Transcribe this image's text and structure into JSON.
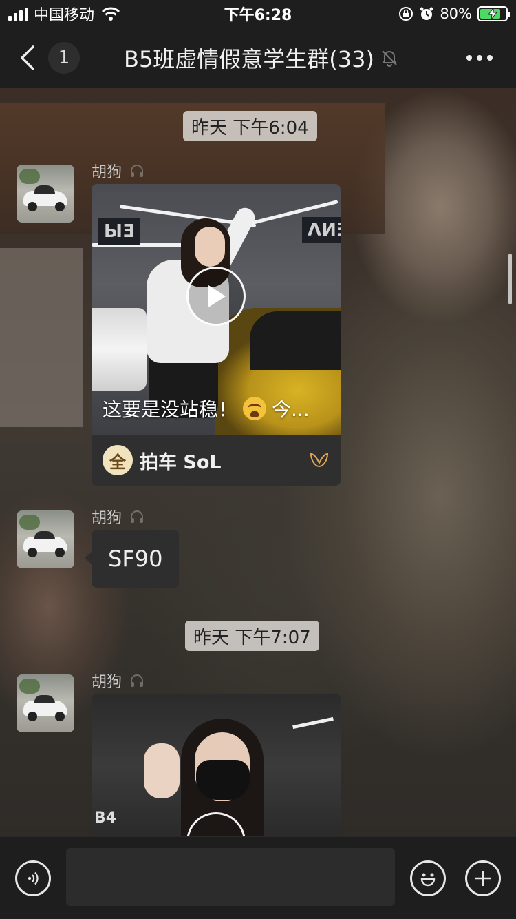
{
  "status_bar": {
    "carrier": "中国移动",
    "time": "下午6:28",
    "battery_percent": "80%",
    "battery_level": 0.8
  },
  "nav": {
    "unread_count": "1",
    "title": "B5班虚情假意学生群(33)",
    "icons": [
      "chevron-left-icon",
      "mute-bell-icon",
      "more-dots-icon"
    ]
  },
  "messages": [
    {
      "type": "timestamp",
      "text": "昨天 下午6:04"
    },
    {
      "type": "video",
      "sender": "胡狗",
      "caption": "这要是没站稳！",
      "caption_tail": "今...",
      "channel_name": "拍车 SoL",
      "channel_logo_char": "全"
    },
    {
      "type": "text",
      "sender": "胡狗",
      "text": "SF90"
    },
    {
      "type": "timestamp",
      "text": "昨天 下午7:07"
    },
    {
      "type": "video",
      "sender": "胡狗",
      "thumb_sign": "B4"
    }
  ],
  "input_bar": {
    "value": "",
    "icons": [
      "voice-icon",
      "emoji-icon",
      "plus-icon"
    ]
  },
  "colors": {
    "bar_bg": "#1e1e1e",
    "bubble_bg": "#2e2e2e",
    "timestamp_bg": "#dcd7d2",
    "battery_green": "#4cd964"
  }
}
